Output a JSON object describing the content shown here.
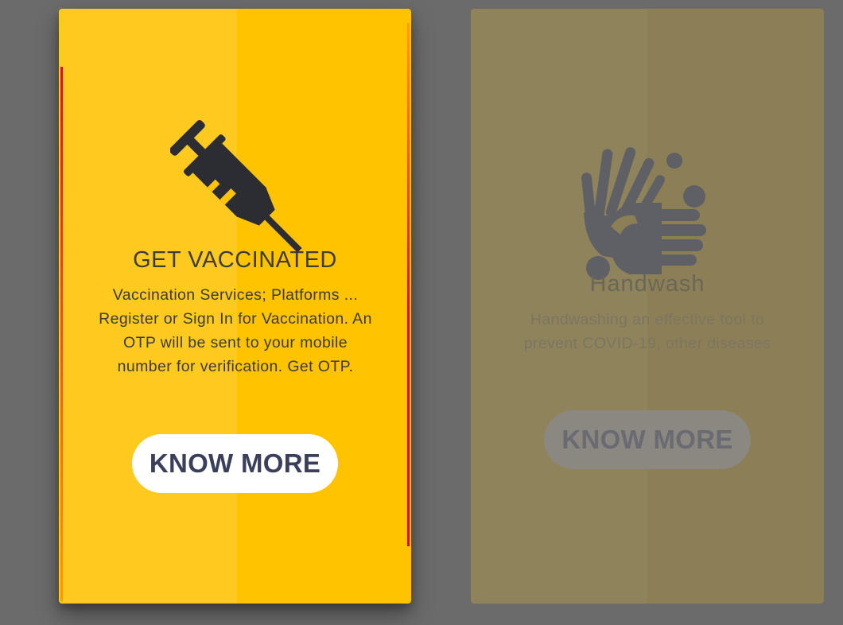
{
  "cards": [
    {
      "title": "GET VACCINATED",
      "description": "Vaccination Services; Platforms ... Register or Sign In for Vaccination. An OTP will be sent to your mobile number for verification. Get OTP.",
      "button_label": "KNOW MORE",
      "icon": "syringe-icon",
      "active": true
    },
    {
      "title": "Handwash",
      "description": "Handwashing an effective tool to prevent COVID-19, other diseases",
      "button_label": "KNOW MORE",
      "icon": "handwash-icon",
      "active": false
    }
  ],
  "colors": {
    "page_background": "#6b6b6b",
    "active_card": "#ffc300",
    "dim_card": "#8c7f56",
    "button_text": "#3a3f5c",
    "icon": "#2b2d33"
  }
}
